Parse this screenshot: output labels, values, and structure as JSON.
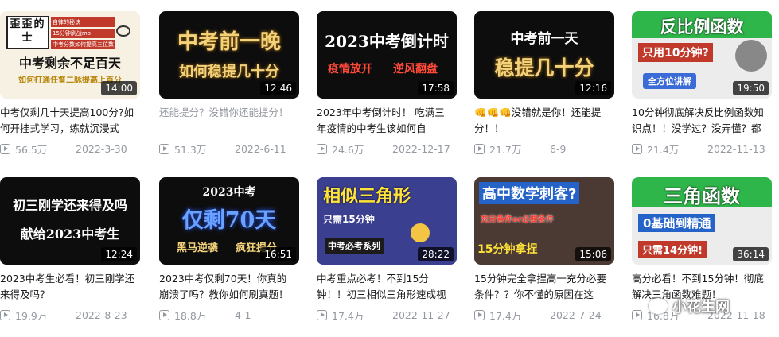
{
  "videos_row1": [
    {
      "duration": "14:00",
      "title": "中考仅剩几十天提高100分?如何开挂式学习，练就沉浸式",
      "views": "56.5万",
      "date": "2022-3-30",
      "thumb": {
        "l1": "歪歪的士",
        "l2": "中考剩余不足百天",
        "l3": "如何打通任督二脉提高上百分",
        "side": [
          "自律的秘诀",
          "15分钟刷战mo",
          "中考分数如何提高三位数"
        ]
      }
    },
    {
      "duration": "12:46",
      "title": "还能提分？没错你还能提分！",
      "title_gray": true,
      "views": "51.3万",
      "date": "2022-6-11",
      "thumb": {
        "l1": "中考前一晚",
        "l2": "如何稳提几十分"
      }
    },
    {
      "duration": "17:58",
      "title": "2023年中考倒计时！ 吃满三年疫情的中考生该如何自",
      "views": "24.6万",
      "date": "2022-12-17",
      "thumb": {
        "l1": "2023中考倒计时",
        "l2": "疫情放开",
        "l3": "逆风翻盘"
      }
    },
    {
      "duration": "12:16",
      "title": "👊👊👊没错就是你！还能提分！！",
      "views": "21.7万",
      "date": "6-9",
      "thumb": {
        "l1": "中考前一天",
        "l2": "稳提几十分"
      }
    },
    {
      "duration": "19:50",
      "title": "10分钟彻底解决反比例函数知识点！！没学过？没弄懂？都",
      "views": "21.4万",
      "date": "2022-11-13",
      "thumb": {
        "l1": "反比例函数",
        "l2": "只用10分钟?",
        "l3": "全方位讲解"
      }
    }
  ],
  "videos_row2": [
    {
      "duration": "12:24",
      "title": "2023中考生必看！初三刚学还来得及吗？",
      "views": "19.9万",
      "date": "2022-8-23",
      "thumb": {
        "l1": "初三刚学还来得及吗",
        "l2": "献给2023中考生"
      }
    },
    {
      "duration": "16:51",
      "title": "2023中考仅剩70天！你真的崩溃了吗？教你如何刷真题！",
      "views": "18.8万",
      "date": "4-1",
      "thumb": {
        "l1": "2023中考",
        "l2": "仅剩70天",
        "l3": "黑马逆袭",
        "l4": "疯狂提分"
      }
    },
    {
      "duration": "28:22",
      "title": "中考重点必考！不到15分钟！！初三相似三角形速成视",
      "views": "17.4万",
      "date": "2022-11-27",
      "thumb": {
        "l1": "相似三角形",
        "l2": "只需15分钟",
        "l3": "中考必考系列"
      }
    },
    {
      "duration": "15:06",
      "title": "15分钟完全拿捏高一充分必要条件？？你不懂的原因在这",
      "views": "17.4万",
      "date": "2022-7-24",
      "thumb": {
        "l1": "高中数学刺客?",
        "l2": "充分条件or必要条件",
        "l3": "15分钟拿捏"
      }
    },
    {
      "duration": "36:14",
      "title": "高分必看！不到15分钟！彻底解决三角函数难题！",
      "views": "16.8万",
      "date": "2022-11-18",
      "thumb": {
        "l1": "三角函数",
        "l2": "0基础到精通",
        "l3": "只需14分钟!"
      }
    }
  ],
  "watermark": "小花生网",
  "colors": {
    "title": "#18191c",
    "meta": "#9499a0",
    "gold": "#f3d27a",
    "accent_red": "#ff3b2f",
    "green": "#2fb64a"
  }
}
